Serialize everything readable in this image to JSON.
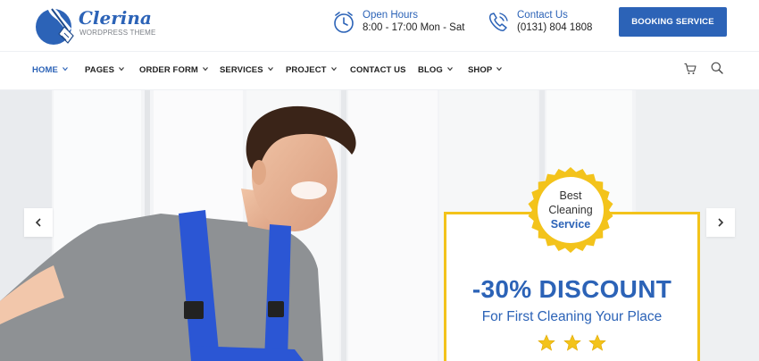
{
  "brand": {
    "name": "Clerina",
    "tagline": "WORDPRESS THEME",
    "color": "#2c63b7"
  },
  "header": {
    "hours": {
      "title": "Open Hours",
      "value": "8:00 - 17:00 Mon - Sat",
      "icon": "clock-icon"
    },
    "contact": {
      "title": "Contact Us",
      "value": "(0131) 804 1808",
      "icon": "phone-icon"
    },
    "cta_label": "BOOKING SERVICE"
  },
  "nav": {
    "items": [
      {
        "label": "HOME",
        "active": true
      },
      {
        "label": "PAGES"
      },
      {
        "label": "ORDER FORM"
      },
      {
        "label": "SERVICES"
      },
      {
        "label": "PROJECT"
      },
      {
        "label": "CONTACT US"
      },
      {
        "label": "BLOG"
      },
      {
        "label": "SHOP"
      }
    ],
    "icons": [
      "cart-icon",
      "search-icon"
    ]
  },
  "hero": {
    "badge": {
      "line1": "Best",
      "line2": "Cleaning",
      "line3": "Service"
    },
    "discount": "-30% DISCOUNT",
    "subline": "For First Cleaning Your Place",
    "stars": 3,
    "accent": "#f3c31b"
  }
}
